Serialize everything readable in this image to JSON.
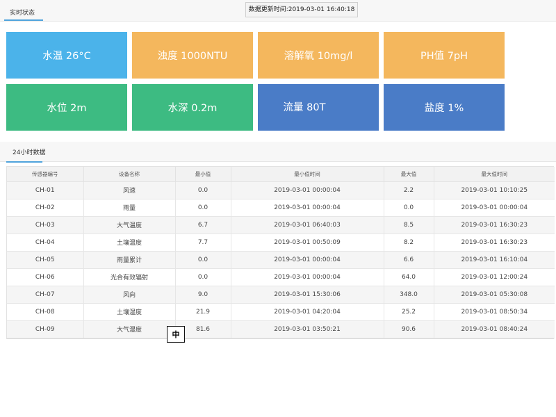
{
  "header": {
    "tab_label": "实时状态",
    "update_text": "数据更新时间:2019-03-01 16:40:18"
  },
  "tiles": [
    {
      "label": "水温 26°C"
    },
    {
      "label": "浊度 1000NTU"
    },
    {
      "label": "溶解氧 10mg/l"
    },
    {
      "label": "PH值 7pH"
    },
    {
      "label": "水位 2m"
    },
    {
      "label": "水深 0.2m"
    },
    {
      "label": "流量 80T"
    },
    {
      "label": "盐度 1%"
    }
  ],
  "colors": {
    "blue_light": "#4bb3ea",
    "orange": "#f4b75d",
    "green": "#3dbb82",
    "blue_dark": "#4a7cc7",
    "accent": "#4fa3dc"
  },
  "panel": {
    "tab_label": "24小时数据"
  },
  "table": {
    "columns": [
      "传感器编号",
      "设备名称",
      "最小值",
      "最小值时间",
      "最大值",
      "最大值时间"
    ],
    "rows": [
      [
        "CH-01",
        "风速",
        "0.0",
        "2019-03-01 00:00:04",
        "2.2",
        "2019-03-01 10:10:25"
      ],
      [
        "CH-02",
        "雨量",
        "0.0",
        "2019-03-01 00:00:04",
        "0.0",
        "2019-03-01 00:00:04"
      ],
      [
        "CH-03",
        "大气温度",
        "6.7",
        "2019-03-01 06:40:03",
        "8.5",
        "2019-03-01 16:30:23"
      ],
      [
        "CH-04",
        "土壤温度",
        "7.7",
        "2019-03-01 00:50:09",
        "8.2",
        "2019-03-01 16:30:23"
      ],
      [
        "CH-05",
        "雨量累计",
        "0.0",
        "2019-03-01 00:00:04",
        "6.6",
        "2019-03-01 16:10:04"
      ],
      [
        "CH-06",
        "光合有效辐射",
        "0.0",
        "2019-03-01 00:00:04",
        "64.0",
        "2019-03-01 12:00:24"
      ],
      [
        "CH-07",
        "风向",
        "9.0",
        "2019-03-01 15:30:06",
        "348.0",
        "2019-03-01 05:30:08"
      ],
      [
        "CH-08",
        "土壤湿度",
        "21.9",
        "2019-03-01 04:20:04",
        "25.2",
        "2019-03-01 08:50:34"
      ],
      [
        "CH-09",
        "大气湿度",
        "81.6",
        "2019-03-01 03:50:21",
        "90.6",
        "2019-03-01 08:40:24"
      ]
    ]
  },
  "ime_indicator": "中"
}
